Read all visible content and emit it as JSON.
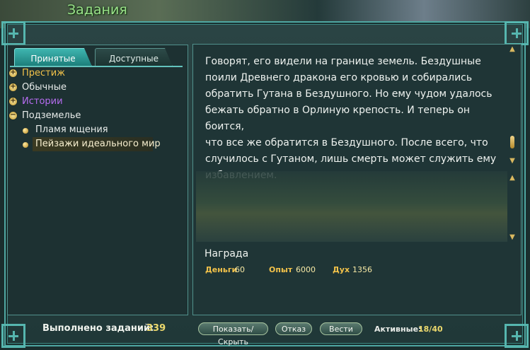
{
  "window": {
    "title": "Задания"
  },
  "tabs": [
    {
      "label": "Принятые",
      "active": true
    },
    {
      "label": "Доступные",
      "active": false
    }
  ],
  "quest_tree": {
    "categories": [
      {
        "label": "Престиж",
        "state": "collapsed",
        "color": "#f2c24a"
      },
      {
        "label": "Обычные",
        "state": "collapsed",
        "color": "#e8ecea"
      },
      {
        "label": "Истории",
        "state": "collapsed",
        "color": "#b66cf0"
      },
      {
        "label": "Подземелье",
        "state": "expanded",
        "color": "#e8ecea"
      }
    ],
    "quests": [
      {
        "label": "Пламя мщения",
        "selected": false
      },
      {
        "label": "Пейзажи идеального мир",
        "selected": true
      }
    ]
  },
  "quest_detail": {
    "text": " Говорят, его видели на границе земель. Бездушные\nпоили Древнего дракона его кровью и собирались\nобратить Гутана в Бездушного. Но ему чудом удалось\nбежать обратно в Орлиную крепость. И теперь он боится,\n что все же обратится в Бездушного. После всего, что\nслучилось с Гутаном, лишь смерть может служить ему\nизбавлением.",
    "reward_title": "Награда",
    "rewards": [
      {
        "label": "Деньги",
        "value": "60"
      },
      {
        "label": "Опыт",
        "value": "6000"
      },
      {
        "label": "Дух",
        "value": "1356"
      }
    ]
  },
  "footer": {
    "completed_label": "Выполнено заданий:",
    "completed_value": "339",
    "buttons": {
      "toggle": "Показать/Скрыть",
      "abandon": "Отказ",
      "track": "Вести"
    },
    "active_label": "Активные:",
    "active_value": "18/40"
  },
  "icons": {
    "scroll_up": "scroll-up-arrow-icon",
    "scroll_down": "scroll-down-arrow-icon",
    "expand": "plus-expander-icon",
    "collapse": "minus-expander-icon",
    "quest_bullet": "gold-bullet-icon"
  }
}
